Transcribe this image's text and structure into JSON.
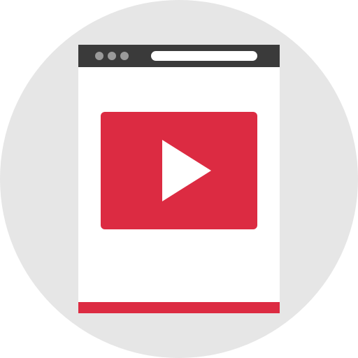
{
  "icon": "video-player-in-browser-window",
  "colors": {
    "background_circle": "#e6e6e6",
    "titlebar": "#3a3a3a",
    "window_dots": "#9a9a9a",
    "address_bar": "#ffffff",
    "page": "#ffffff",
    "accent": "#dc2b42",
    "play_triangle": "#ffffff"
  }
}
